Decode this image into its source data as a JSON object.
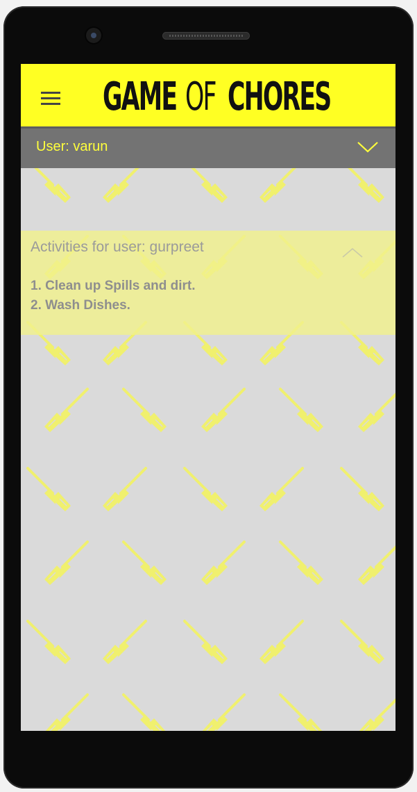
{
  "app": {
    "brand_part1": "GAME",
    "brand_part2": "OF",
    "brand_part3": "CHORES"
  },
  "user_selector": {
    "label": "User: varun"
  },
  "activities": {
    "title": "Activities for user: gurpreet",
    "items": [
      "1. Clean up Spills and dirt.",
      "2. Wash Dishes."
    ]
  },
  "icons": {
    "menu": "hamburger-menu-icon",
    "user_toggle": "chevron-down-icon",
    "collapse": "chevron-up-icon",
    "pattern": "broom-icon"
  },
  "colors": {
    "header_bg": "#ffff23",
    "user_bar_bg": "#737373",
    "user_text": "#ffff3c",
    "screen_bg": "#dadada",
    "broom": "#f0f06e",
    "activities_bg": "#f0f08c"
  }
}
